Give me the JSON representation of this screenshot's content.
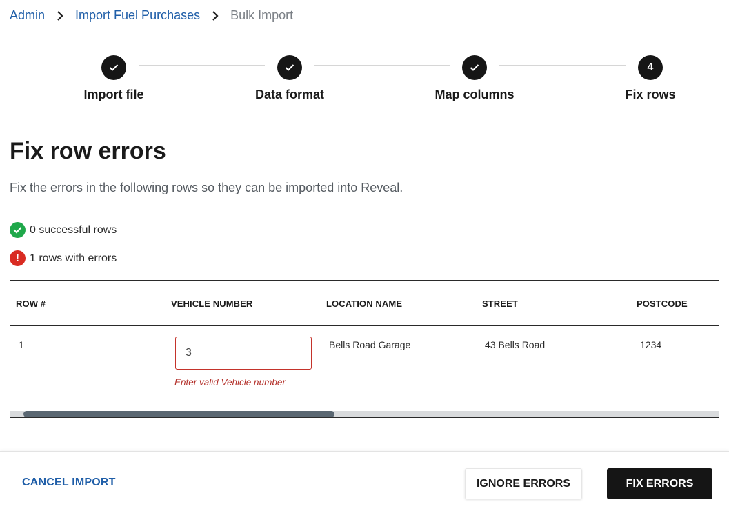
{
  "breadcrumb": {
    "items": [
      {
        "label": "Admin",
        "link": true
      },
      {
        "label": "Import Fuel Purchases",
        "link": true
      },
      {
        "label": "Bulk Import",
        "link": false
      }
    ],
    "separator_icon": "chevron-right-icon"
  },
  "stepper": {
    "steps": [
      {
        "label": "Import file",
        "state": "complete",
        "icon": "check-icon"
      },
      {
        "label": "Data format",
        "state": "complete",
        "icon": "check-icon"
      },
      {
        "label": "Map columns",
        "state": "complete",
        "icon": "check-icon"
      },
      {
        "label": "Fix rows",
        "state": "current",
        "number": "4"
      }
    ]
  },
  "page": {
    "title": "Fix row errors",
    "subtitle": "Fix the errors in the following rows so they can be imported into Reveal."
  },
  "summary": {
    "success_text": "0 successful rows",
    "error_text": "1 rows with errors",
    "success_icon": "check-circle-icon",
    "error_icon": "exclamation-circle-icon",
    "success_color": "#1fa84a",
    "error_color": "#d92b22"
  },
  "table": {
    "columns": [
      "ROW #",
      "VEHICLE NUMBER",
      "LOCATION NAME",
      "STREET",
      "POSTCODE"
    ],
    "rows": [
      {
        "row_number": "1",
        "vehicle_number": "3",
        "vehicle_error": "Enter valid Vehicle number",
        "location_name": "Bells Road Garage",
        "street": "43 Bells Road",
        "postcode": "1234"
      }
    ]
  },
  "footer": {
    "cancel_label": "CANCEL IMPORT",
    "ignore_label": "IGNORE ERRORS",
    "fix_label": "FIX ERRORS"
  },
  "colors": {
    "link": "#1f5ea8",
    "primary_button": "#151515",
    "error": "#c4332b"
  }
}
